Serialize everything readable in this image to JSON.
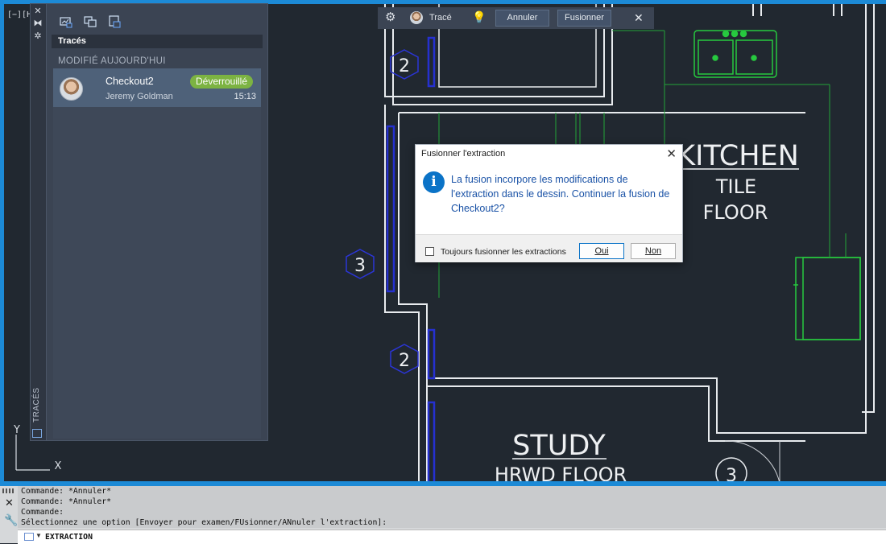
{
  "viewport": {
    "label": "[−][H"
  },
  "palette": {
    "vertical_label": "TRACÉS",
    "section_title": "Tracés",
    "group_label": "MODIFIÉ AUJOURD'HUI",
    "trace": {
      "name": "Checkout2",
      "author": "Jeremy Goldman",
      "status": "Déverrouillé",
      "time": "15:13"
    }
  },
  "trace_toolbar": {
    "label": "Tracé",
    "cancel": "Annuler",
    "merge": "Fusionner"
  },
  "drawing": {
    "kitchen": "KITCHEN",
    "tile": "TILE",
    "floor": "FLOOR",
    "study": "STUDY",
    "hrwd": "HRWD FLOOR",
    "tag_2a": "2",
    "tag_3a": "3",
    "tag_2b": "2",
    "tag_3b": "3",
    "ucs_y": "Y",
    "ucs_x": "X"
  },
  "dialog": {
    "title": "Fusionner l'extraction",
    "message": "La fusion incorpore les modifications de l'extraction dans le dessin. Continuer la fusion de Checkout2?",
    "checkbox_label": "Toujours fusionner les extractions",
    "yes": "Oui",
    "no": "Non"
  },
  "command_line": {
    "history": [
      "Commande: *Annuler*",
      "Commande: *Annuler*",
      "Commande:",
      "Sélectionnez une option [Envoyer pour examen/FUsionner/ANnuler l'extraction]:"
    ],
    "input": "EXTRACTION"
  },
  "colors": {
    "canvas": "#212830",
    "accent": "#1c8ad6",
    "green_layer": "#27c93f",
    "badge": "#7cb342"
  }
}
